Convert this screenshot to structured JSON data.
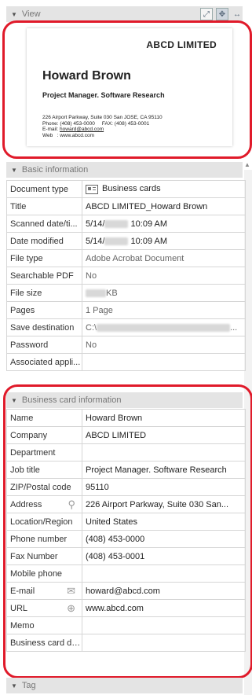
{
  "view": {
    "header_label": "View",
    "card": {
      "company": "ABCD LIMITED",
      "name": "Howard Brown",
      "job_title": "Project Manager. Software Research",
      "address_line": "226 Airport Parkway, Suite 030 San JOSE, CA 95110",
      "phone_line": "Phone: (408) 453-0000     FAX: (408) 453-0001",
      "email_prefix": "E-mail: ",
      "email_value": "howard@abcd.com",
      "web_line": "Web   : www.abcd.com"
    }
  },
  "basic": {
    "header_label": "Basic information",
    "rows": [
      {
        "label": "Document type",
        "value": "Business cards"
      },
      {
        "label": "Title",
        "value": "ABCD LIMITED_Howard Brown"
      },
      {
        "label": "Scanned date/ti...",
        "value_prefix": "5/14/",
        "value_suffix": "10:09 AM"
      },
      {
        "label": "Date modified",
        "value_prefix": "5/14/",
        "value_suffix": "10:09 AM"
      },
      {
        "label": "File type",
        "value": "Adobe Acrobat Document"
      },
      {
        "label": "Searchable PDF",
        "value": "No"
      },
      {
        "label": "File size",
        "value_suffix": "KB"
      },
      {
        "label": "Pages",
        "value": "1 Page"
      },
      {
        "label": "Save destination",
        "value_prefix": "C:\\",
        "value_suffix": "..."
      },
      {
        "label": "Password",
        "value": "No"
      },
      {
        "label": "Associated appli...",
        "value": ""
      }
    ]
  },
  "bizcard": {
    "header_label": "Business card information",
    "rows": [
      {
        "label": "Name",
        "value": "Howard Brown"
      },
      {
        "label": "Company",
        "value": "ABCD LIMITED"
      },
      {
        "label": "Department",
        "value": ""
      },
      {
        "label": "Job title",
        "value": "Project Manager. Software Research"
      },
      {
        "label": "ZIP/Postal code",
        "value": "95110"
      },
      {
        "label": "Address",
        "value": "226 Airport Parkway, Suite 030 San..."
      },
      {
        "label": "Location/Region",
        "value": "United States"
      },
      {
        "label": "Phone number",
        "value": "(408) 453-0000"
      },
      {
        "label": "Fax Number",
        "value": "(408) 453-0001"
      },
      {
        "label": "Mobile phone",
        "value": ""
      },
      {
        "label": "E-mail",
        "value": "howard@abcd.com"
      },
      {
        "label": "URL",
        "value": "www.abcd.com"
      },
      {
        "label": "Memo",
        "value": ""
      },
      {
        "label": "Business card da...",
        "value": ""
      }
    ]
  },
  "tag": {
    "header_label": "Tag"
  },
  "icons": {
    "collapse": "triangle-down-icon",
    "address": "map-pin-icon",
    "email": "envelope-icon",
    "url": "globe-icon",
    "doc_type": "business-card-icon"
  },
  "colors": {
    "highlight": "#e01a2a",
    "header_bg": "#e4e4e4",
    "grid_line": "#d6d6d6"
  }
}
